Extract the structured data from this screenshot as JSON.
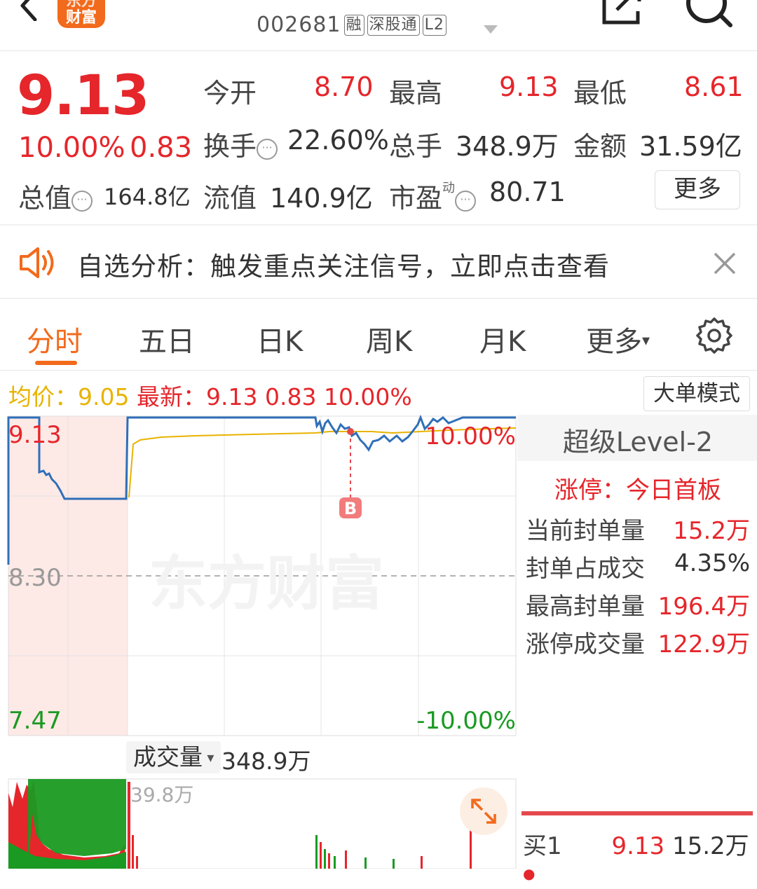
{
  "header": {
    "logo_line1": "东方",
    "logo_line2": "财富",
    "code": "002681",
    "tags": [
      "融",
      "深股通",
      "L2"
    ]
  },
  "quote": {
    "price": "9.13",
    "change_pct": "10.00%",
    "change": "0.83",
    "open_label": "今开",
    "open": "8.70",
    "high_label": "最高",
    "high": "9.13",
    "low_label": "最低",
    "low": "8.61",
    "turnover_label": "换手",
    "turnover": "22.60%",
    "volume_label": "总手",
    "volume": "348.9万",
    "amount_label": "金额",
    "amount": "31.59亿",
    "mktcap_label": "总值",
    "mktcap": "164.8亿",
    "float_label": "流值",
    "float": "140.9亿",
    "pe_label": "市盈",
    "pe_sup": "动",
    "pe": "80.71",
    "more_label": "更多"
  },
  "notice": {
    "text": "自选分析：触发重点关注信号，立即点击查看"
  },
  "tabs": [
    "分时",
    "五日",
    "日K",
    "周K",
    "月K",
    "更多"
  ],
  "info_line": {
    "avg_label": "均价：",
    "avg": "9.05",
    "latest_label": "最新：",
    "latest": "9.13",
    "change": "0.83",
    "pct": "10.00%",
    "mode_button": "大单模式"
  },
  "chart_data": {
    "type": "line",
    "y_top": "9.13",
    "y_mid": "8.30",
    "y_bottom": "7.47",
    "pct_top": "10.00%",
    "pct_bottom": "-10.00%",
    "marker": "B",
    "watermark": "东方财富",
    "price_series": [
      9.13,
      9.13,
      9.13,
      8.81,
      8.8,
      8.79,
      8.79,
      9.13,
      9.13,
      9.13,
      9.13,
      9.13,
      9.12,
      9.1,
      9.09,
      9.12,
      9.13,
      9.13
    ],
    "avg_series": [
      null,
      null,
      null,
      null,
      null,
      null,
      null,
      9.0,
      9.03,
      9.04,
      9.05,
      9.05,
      9.05,
      9.05,
      9.05,
      9.05,
      9.05,
      9.05
    ],
    "volume_label": "成交量",
    "volume_total": "348.9万",
    "volume_max": "39.8万"
  },
  "level2": {
    "title": "超级Level-2",
    "subtitle": "涨停：今日首板",
    "rows": [
      {
        "k": "当前封单量",
        "v": "15.2万"
      },
      {
        "k": "封单占成交",
        "v": "4.35%"
      },
      {
        "k": "最高封单量",
        "v": "196.4万"
      },
      {
        "k": "涨停成交量",
        "v": "122.9万"
      }
    ],
    "buy1_label": "买1",
    "buy1_price": "9.13",
    "buy1_vol": "15.2万"
  },
  "colors": {
    "up": "#e5262b",
    "down": "#1a9a22",
    "accent": "#f26a1b",
    "avg": "#e8b300",
    "price": "#2f6fb8"
  }
}
